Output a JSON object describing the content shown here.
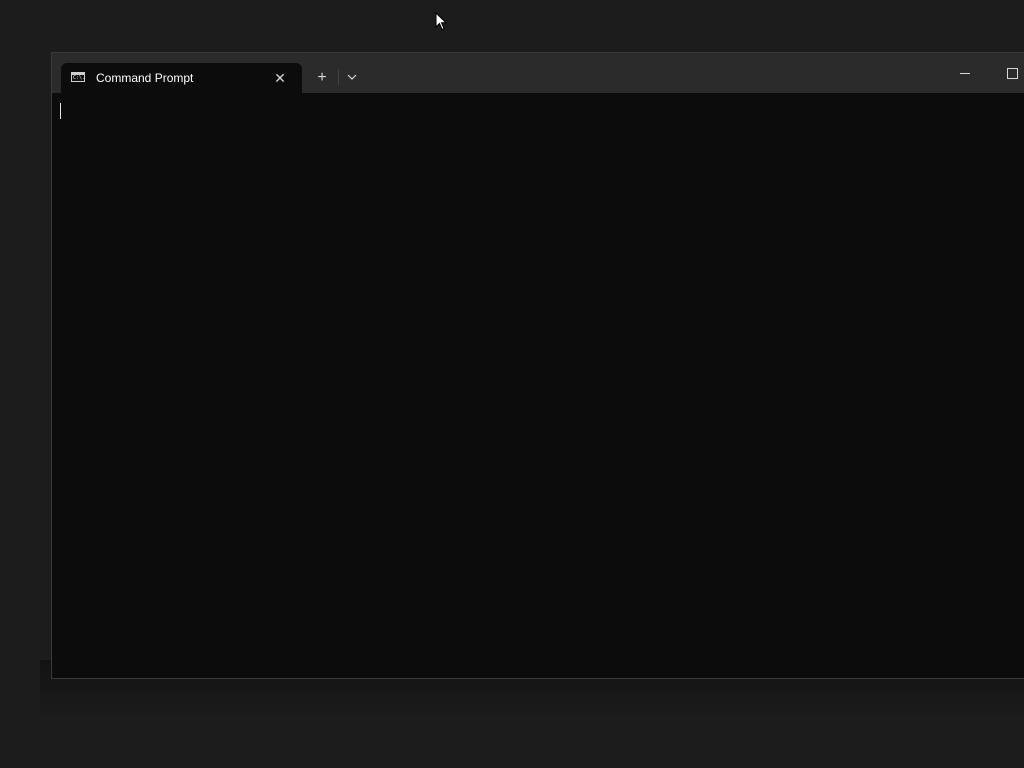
{
  "window": {
    "tab": {
      "title": "Command Prompt",
      "icon": "cmd-icon",
      "icon_glyph": "C:\\."
    },
    "titlebar": {
      "close_tab_glyph": "✕",
      "new_tab_glyph": "+",
      "dropdown_icon": "chevron-down-icon",
      "minimize_icon": "minimize-icon",
      "maximize_icon": "maximize-icon"
    },
    "terminal": {
      "content": ""
    }
  },
  "colors": {
    "desktop": "#1c1c1c",
    "titlebar": "#2b2b2b",
    "terminal_bg": "#0c0c0c",
    "text": "#ffffff"
  }
}
